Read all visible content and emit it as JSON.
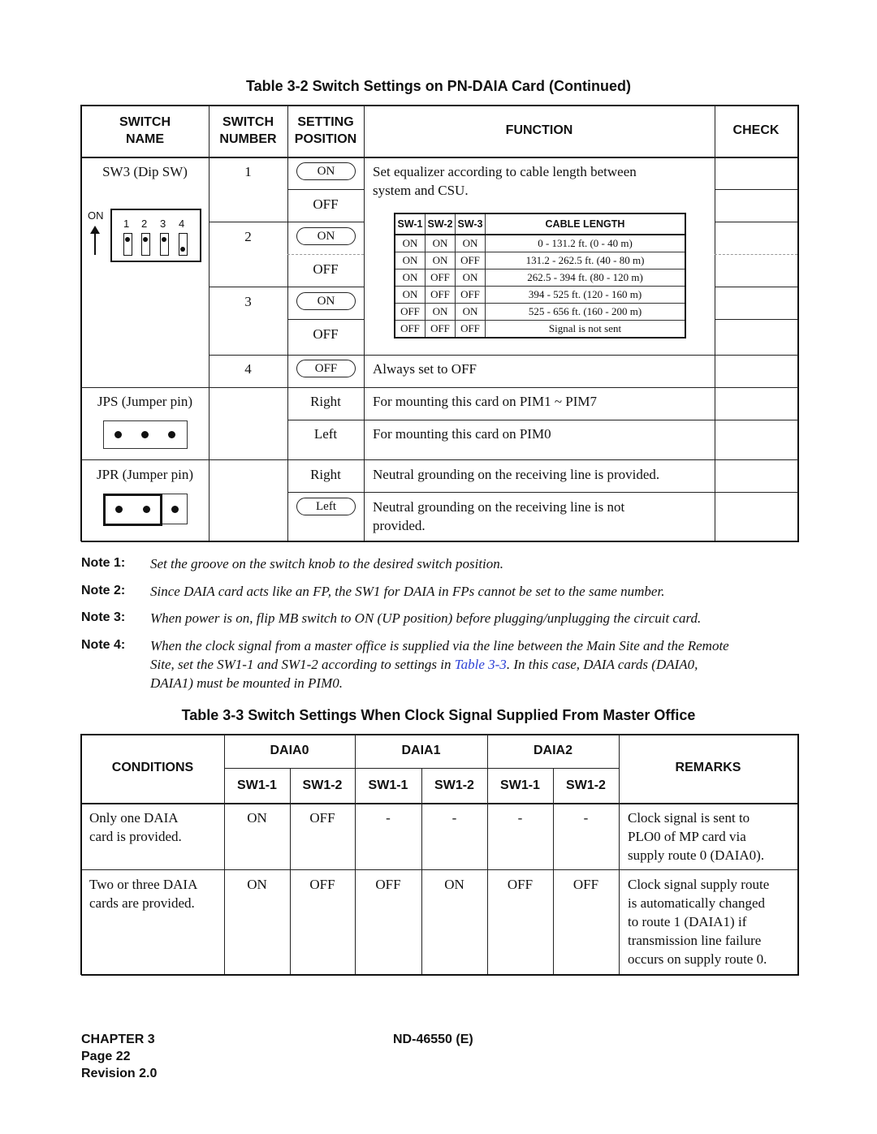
{
  "table2": {
    "title": "Table 3-2  Switch Settings on PN-DAIA Card  (Continued)",
    "headers": {
      "switch_name": [
        "SWITCH",
        "NAME"
      ],
      "switch_number": [
        "SWITCH",
        "NUMBER"
      ],
      "setting_position": [
        "SETTING",
        "POSITION"
      ],
      "function": "FUNCTION",
      "check": "CHECK"
    },
    "sw3": {
      "name": "SW3 (Dip SW)",
      "dip_on_label": "ON",
      "dip_numbers": [
        "1",
        "2",
        "3",
        "4"
      ],
      "dip_states": [
        "ON",
        "ON",
        "ON",
        "OFF"
      ],
      "switches": [
        {
          "number": "1",
          "on": "ON",
          "off": "OFF"
        },
        {
          "number": "2",
          "on": "ON",
          "off": "OFF"
        },
        {
          "number": "3",
          "on": "ON",
          "off": "OFF"
        }
      ],
      "function": [
        "Set equalizer according to cable length between",
        "system and CSU."
      ],
      "cable_table": {
        "headers": [
          "SW-1",
          "SW-2",
          "SW-3",
          "CABLE LENGTH"
        ],
        "rows": [
          [
            "ON",
            "ON",
            "ON",
            "0 - 131.2 ft. (0 - 40 m)"
          ],
          [
            "ON",
            "ON",
            "OFF",
            "131.2 - 262.5 ft. (40 - 80 m)"
          ],
          [
            "ON",
            "OFF",
            "ON",
            "262.5 - 394 ft. (80 - 120 m)"
          ],
          [
            "ON",
            "OFF",
            "OFF",
            "394 - 525 ft. (120 - 160 m)"
          ],
          [
            "OFF",
            "ON",
            "ON",
            "525 - 656 ft. (160 - 200 m)"
          ],
          [
            "OFF",
            "OFF",
            "OFF",
            "Signal is not sent"
          ]
        ]
      },
      "switch4": {
        "number": "4",
        "setting": "OFF",
        "function": "Always set to OFF"
      }
    },
    "jps": {
      "name": "JPS (Jumper pin)",
      "rows": [
        {
          "setting": "Right",
          "function": "For mounting this card on PIM1 ~ PIM7"
        },
        {
          "setting": "Left",
          "function": "For mounting this card on PIM0"
        }
      ]
    },
    "jpr": {
      "name": "JPR (Jumper pin)",
      "rows": [
        {
          "setting": "Right",
          "function": "Neutral grounding on the receiving line is provided."
        },
        {
          "setting": "Left",
          "function": [
            "Neutral grounding on the receiving line is not",
            "provided."
          ]
        }
      ]
    }
  },
  "notes": [
    {
      "label": "Note 1:",
      "text": "Set the groove on the switch knob to the desired switch position."
    },
    {
      "label": "Note 2:",
      "text": "Since DAIA card acts like an FP, the SW1 for DAIA in FPs cannot be set to the same number."
    },
    {
      "label": "Note 3:",
      "text": "When power is on, flip MB switch to ON (UP position) before plugging/unplugging the circuit card."
    },
    {
      "label": "Note 4:",
      "text_line1": "When the clock signal from a master office is supplied via the line between the Main Site and the Remote",
      "text_line2_pre": "Site, set the SW1-1 and SW1-2 according to settings in ",
      "link": "Table 3-3",
      "text_line2_post": ". In this case, DAIA cards (DAIA0,",
      "text_line3": "DAIA1) must be mounted in PIM0."
    }
  ],
  "table3": {
    "title": "Table 3-3  Switch Settings When Clock Signal Supplied From Master Office",
    "headers": {
      "conditions": "CONDITIONS",
      "groups": [
        "DAIA0",
        "DAIA1",
        "DAIA2"
      ],
      "sub": [
        "SW1-1",
        "SW1-2",
        "SW1-1",
        "SW1-2",
        "SW1-1",
        "SW1-2"
      ],
      "remarks": "REMARKS"
    },
    "rows": [
      {
        "condition": [
          "Only one DAIA",
          "card is provided."
        ],
        "values": [
          "ON",
          "OFF",
          "-",
          "-",
          "-",
          "-"
        ],
        "remarks": [
          "Clock signal is sent to",
          "PLO0 of MP card via",
          "supply route 0 (DAIA0)."
        ]
      },
      {
        "condition": [
          "Two or three DAIA",
          "cards are provided."
        ],
        "values": [
          "ON",
          "OFF",
          "OFF",
          "ON",
          "OFF",
          "OFF"
        ],
        "remarks": [
          "Clock signal supply route",
          "is automatically changed",
          "to route 1 (DAIA1) if",
          "transmission line failure",
          "occurs on supply route 0."
        ]
      }
    ]
  },
  "footer": {
    "chapter": "CHAPTER 3",
    "page": "Page 22",
    "revision": "Revision 2.0",
    "doc_number": "ND-46550 (E)"
  },
  "colors": {
    "link": "#2b3fd6"
  }
}
